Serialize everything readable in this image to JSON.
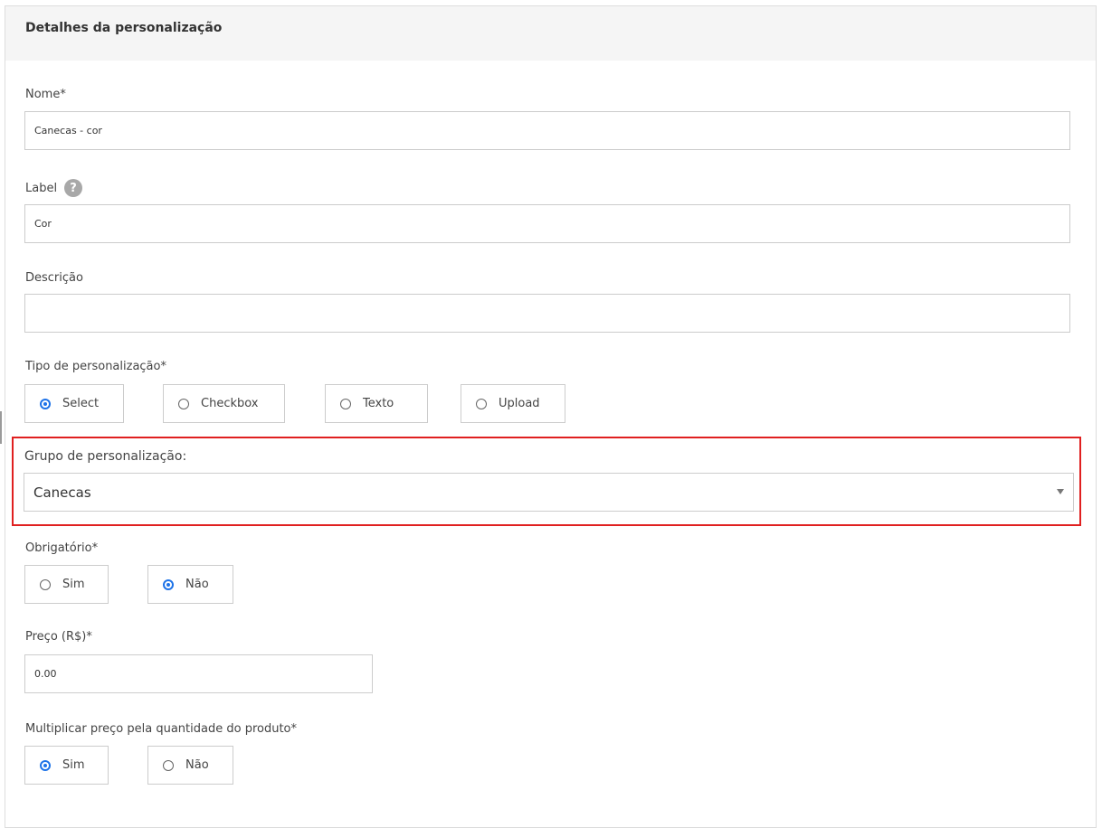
{
  "panel": {
    "title": "Detalhes da personalização"
  },
  "nome": {
    "label": "Nome*",
    "value": "Canecas - cor"
  },
  "label_field": {
    "label": "Label",
    "help_icon": "question-mark-icon",
    "value": "Cor"
  },
  "descricao": {
    "label": "Descrição",
    "value": ""
  },
  "tipo": {
    "label": "Tipo de personalização*",
    "options": [
      {
        "label": "Select",
        "checked": true
      },
      {
        "label": "Checkbox",
        "checked": false
      },
      {
        "label": "Texto",
        "checked": false
      },
      {
        "label": "Upload",
        "checked": false
      }
    ]
  },
  "grupo": {
    "label": "Grupo de personalização:",
    "selected": "Canecas",
    "highlight_color": "#e02020"
  },
  "obrigatorio": {
    "label": "Obrigatório*",
    "options": [
      {
        "label": "Sim",
        "checked": false
      },
      {
        "label": "Não",
        "checked": true
      }
    ]
  },
  "preco": {
    "label": "Preço (R$)*",
    "value": "0.00"
  },
  "multiplicar": {
    "label": "Multiplicar preço pela quantidade do produto*",
    "options": [
      {
        "label": "Sim",
        "checked": true
      },
      {
        "label": "Não",
        "checked": false
      }
    ]
  },
  "colors": {
    "accent": "#1e73e8",
    "border": "#cccccc",
    "header_bg": "#f5f5f5"
  }
}
